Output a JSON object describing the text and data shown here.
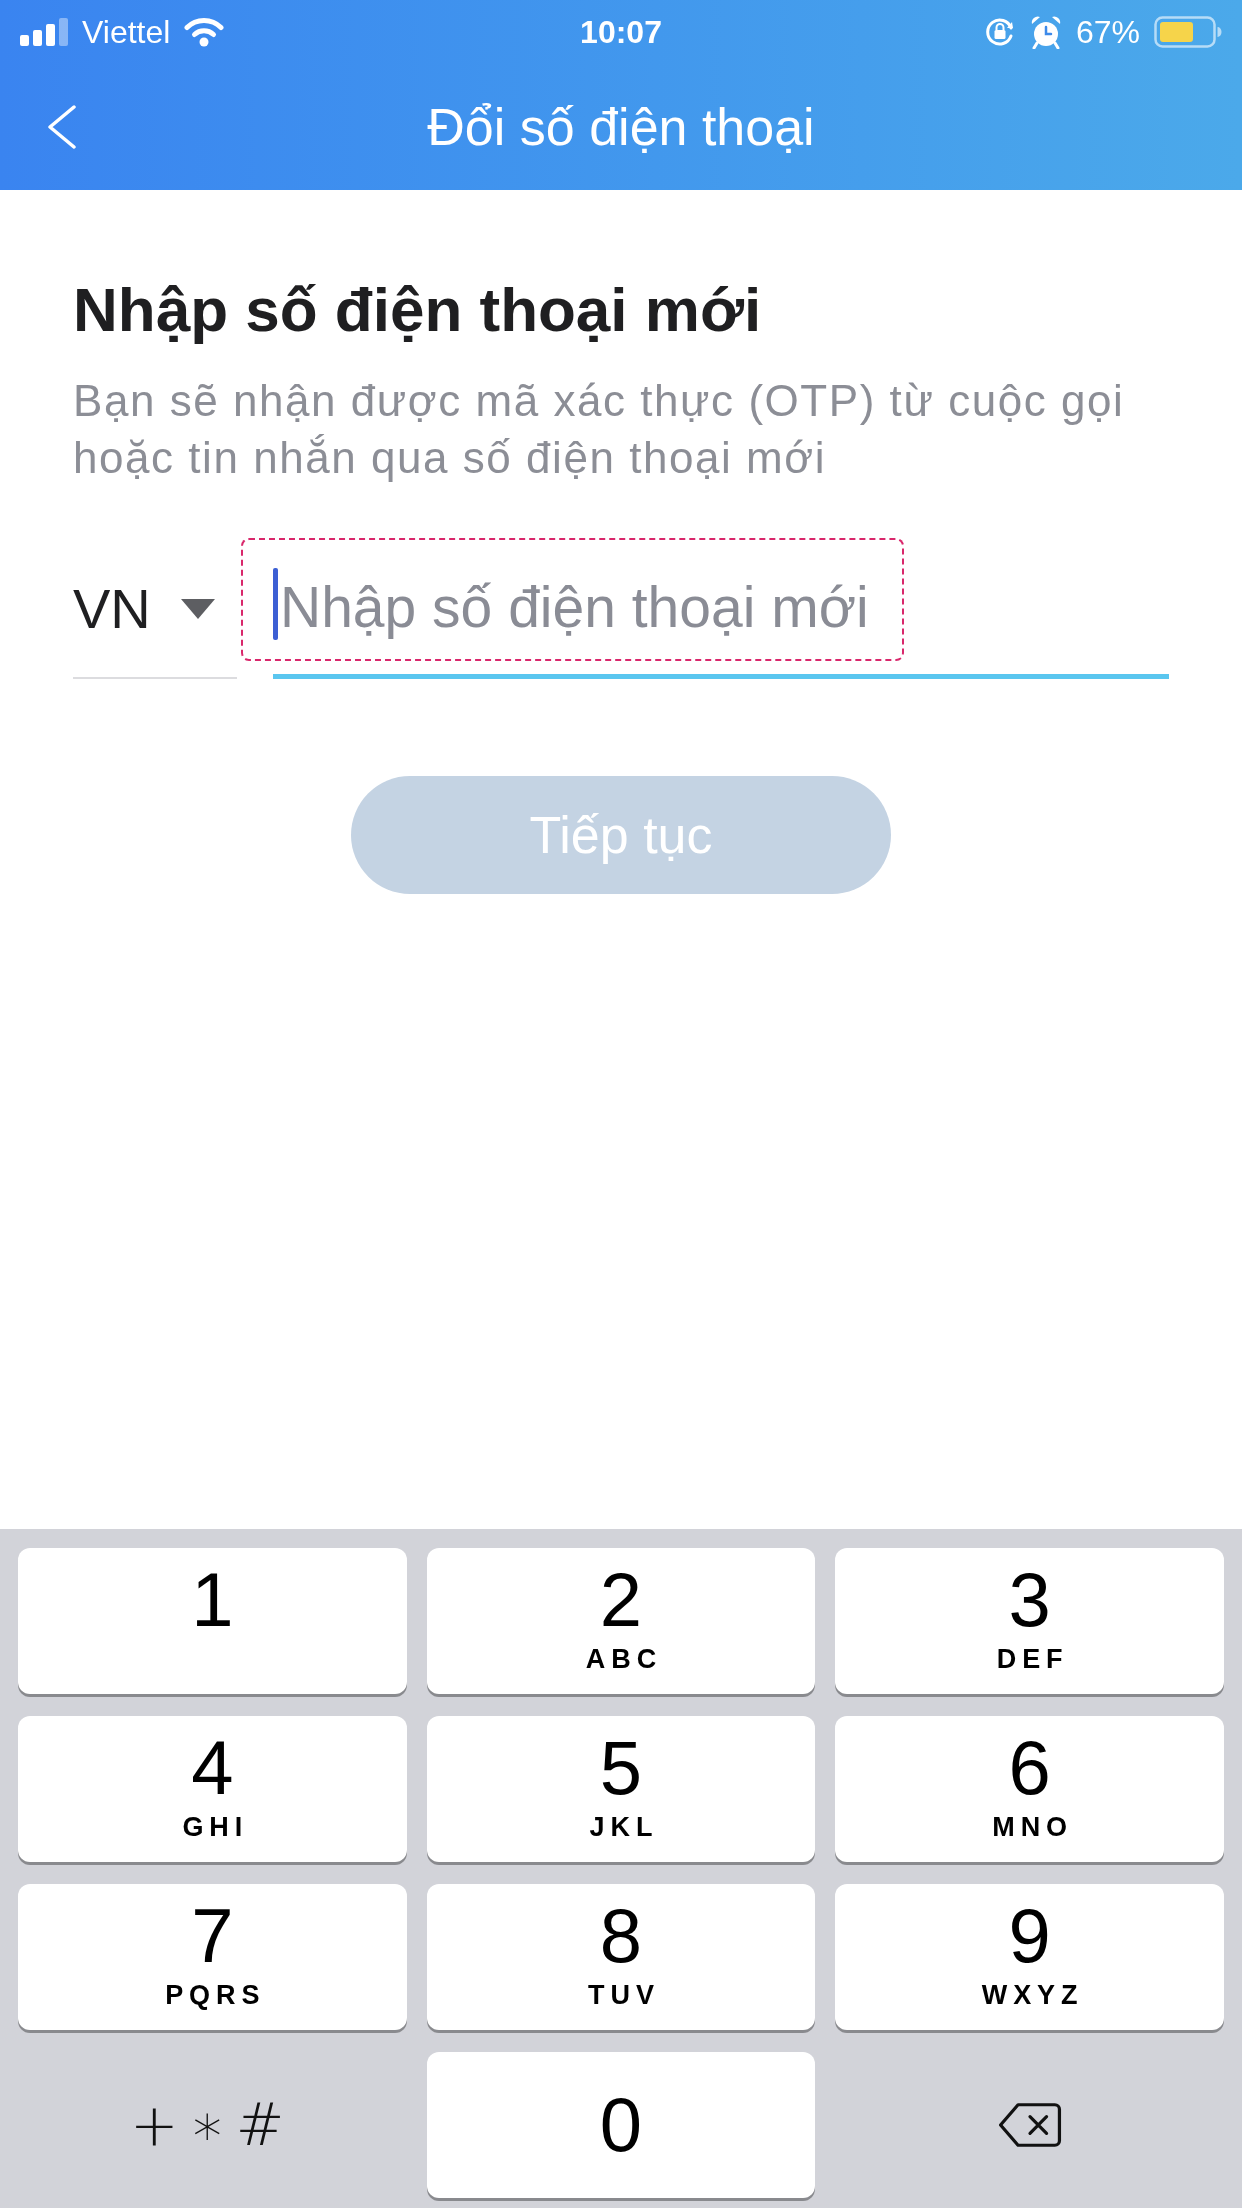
{
  "status_bar": {
    "carrier": "Viettel",
    "time": "10:07",
    "battery": "67%"
  },
  "header": {
    "title": "Đổi số điện thoại"
  },
  "heading": "Nhập số điện thoại mới",
  "description": "Bạn sẽ nhận được mã xác thực (OTP) từ cuộc gọi hoặc tin nhắn qua số điện thoại mới",
  "phone_input": {
    "country": "VN",
    "placeholder": "Nhập số điện thoại mới",
    "focused": true,
    "highlighted": true
  },
  "continue_button": {
    "label": "Tiếp tục",
    "disabled": true
  },
  "keypad": [
    {
      "kind": "digit",
      "digit": "1"
    },
    {
      "kind": "digit",
      "digit": "2",
      "letters": "ABC"
    },
    {
      "kind": "digit",
      "digit": "3",
      "letters": "DEF"
    },
    {
      "kind": "digit",
      "digit": "4",
      "letters": "GHI"
    },
    {
      "kind": "digit",
      "digit": "5",
      "letters": "JKL"
    },
    {
      "kind": "digit",
      "digit": "6",
      "letters": "MNO"
    },
    {
      "kind": "digit",
      "digit": "7",
      "letters": "PQRS"
    },
    {
      "kind": "digit",
      "digit": "8",
      "letters": "TUV"
    },
    {
      "kind": "digit",
      "digit": "9",
      "letters": "WXYZ"
    },
    {
      "kind": "symbols",
      "label": "+∗#"
    },
    {
      "kind": "digit",
      "digit": "0"
    },
    {
      "kind": "backspace"
    }
  ]
}
